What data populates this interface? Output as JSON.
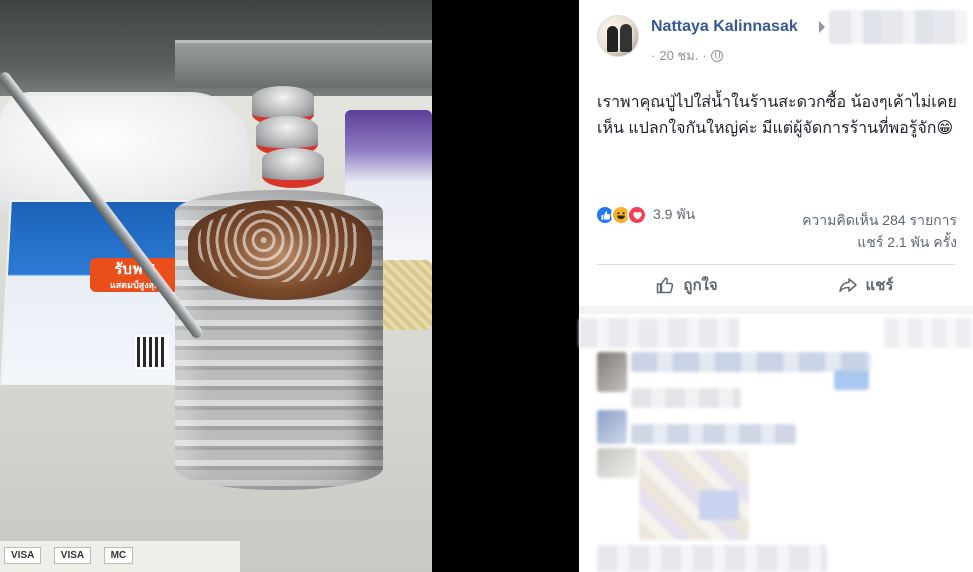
{
  "post": {
    "author": "Nattaya Kalinnasak",
    "time": "20 ชม.",
    "text": "เราพาคุณปู่ไปใส่น้ำในร้านสะดวกซื้อ น้องๆเค้าไม่เคยเห็น แปลกใจกันใหญ่ค่ะ มีแต่ผู้จัดการร้านที่พอรู้จัก😁",
    "reactions_count": "3.9 พัน",
    "comments_count": "ความคิดเห็น 284 รายการ",
    "shares_count": "แชร์ 2.1 พัน ครั้ง"
  },
  "actions": {
    "like_label": "ถูกใจ",
    "share_label": "แชร์"
  },
  "photo": {
    "poster_badge": "รับฟรี!",
    "poster_sub": "แสตมป์สูงสุด",
    "card_labels": [
      "VISA",
      "VISA",
      "MC"
    ]
  },
  "icons": {
    "reactions": [
      "like-icon",
      "haha-icon",
      "love-icon"
    ],
    "privacy": "globe-icon",
    "like_action": "thumbs-up-icon",
    "share_action": "share-arrow-icon"
  },
  "colors": {
    "author_link": "#385898",
    "meta_gray": "#90949c",
    "like_blue": "#2078f4",
    "love_red": "#f33e58",
    "haha_yellow": "#f7b125"
  }
}
